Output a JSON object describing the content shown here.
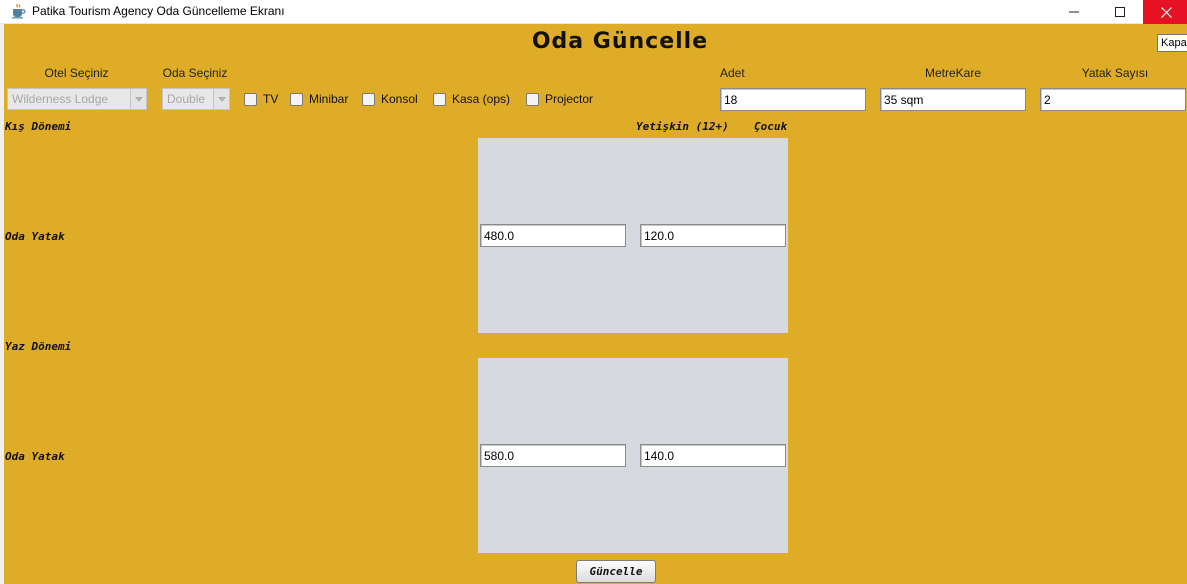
{
  "window": {
    "title": "Patika Tourism Agency Oda Güncelleme Ekranı",
    "icon": "java-cup-icon",
    "controls": {
      "minimize": "minimize-icon",
      "maximize": "maximize-icon",
      "close": "close-icon"
    }
  },
  "heading": "Oda Güncelle",
  "tooltip": "Kapat",
  "hotel": {
    "label": "Otel Seçiniz",
    "selected": "Wilderness Lodge"
  },
  "room": {
    "label": "Oda Seçiniz",
    "selected": "Double"
  },
  "features": [
    {
      "label": "TV",
      "checked": false
    },
    {
      "label": "Minibar",
      "checked": false
    },
    {
      "label": "Konsol",
      "checked": false
    },
    {
      "label": "Kasa (ops)",
      "checked": false
    },
    {
      "label": "Projector",
      "checked": false
    }
  ],
  "stock": {
    "label": "Adet",
    "value": "18"
  },
  "area": {
    "label": "MetreKare",
    "value": "35 sqm"
  },
  "beds": {
    "label": "Yatak Sayısı",
    "value": "2"
  },
  "winter": {
    "label": "Kış Dönemi",
    "row_label": "Oda Yatak",
    "adult": "480.0",
    "child": "120.0"
  },
  "summer": {
    "label": "Yaz Dönemi",
    "row_label": "Oda Yatak",
    "adult": "580.0",
    "child": "140.0"
  },
  "columns": {
    "adult": "Yetişkin (12+)",
    "child": "Çocuk"
  },
  "submit_label": "Güncelle",
  "colors": {
    "panel": "#dfac28",
    "price_box": "#d6d9e0",
    "close": "#e81123"
  }
}
